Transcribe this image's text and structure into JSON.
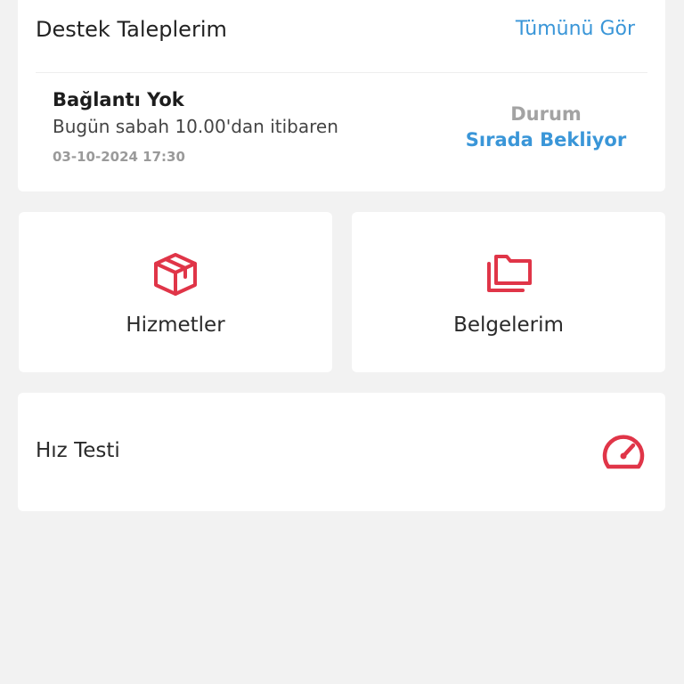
{
  "support": {
    "title": "Destek Taleplerim",
    "see_all": "Tümünü Gör",
    "ticket": {
      "title": "Bağlantı Yok",
      "description": "Bugün sabah 10.00'dan itibaren",
      "date": "03-10-2024 17:30",
      "status_label": "Durum",
      "status_value": "Sırada Bekliyor"
    }
  },
  "tiles": {
    "services": {
      "label": "Hizmetler",
      "icon": "package-icon"
    },
    "documents": {
      "label": "Belgelerim",
      "icon": "folders-icon"
    }
  },
  "speedtest": {
    "label": "Hız Testi",
    "icon": "speedometer-icon"
  },
  "colors": {
    "accent": "#3a96d8",
    "icon": "#e03548",
    "background": "#f2f2f2",
    "card": "#ffffff"
  }
}
